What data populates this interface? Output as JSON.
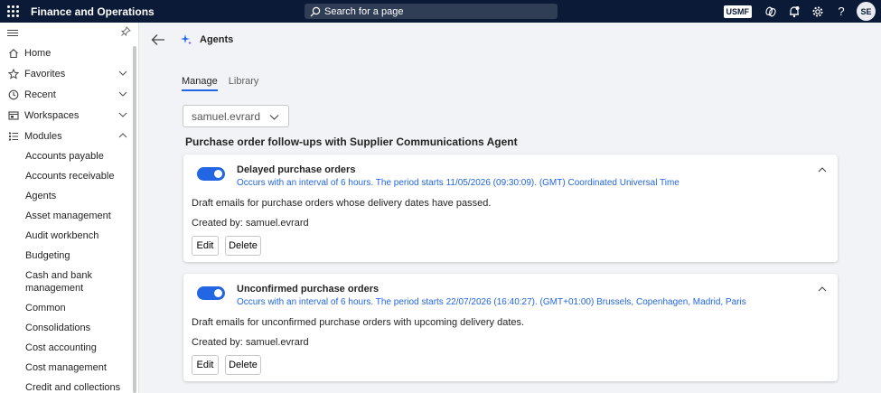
{
  "topbar": {
    "app_title": "Finance and Operations",
    "search_placeholder": "Search for a page",
    "company": "USMF",
    "user_initials": "SE"
  },
  "sidebar": {
    "nav": [
      {
        "label": "Home",
        "icon": "home-icon"
      },
      {
        "label": "Favorites",
        "icon": "star-icon"
      },
      {
        "label": "Recent",
        "icon": "clock-icon"
      },
      {
        "label": "Workspaces",
        "icon": "workspace-icon"
      },
      {
        "label": "Modules",
        "icon": "list-icon"
      }
    ],
    "modules": [
      "Accounts payable",
      "Accounts receivable",
      "Agents",
      "Asset management",
      "Audit workbench",
      "Budgeting",
      "Cash and bank management",
      "Common",
      "Consolidations",
      "Cost accounting",
      "Cost management",
      "Credit and collections"
    ]
  },
  "page": {
    "title": "Agents",
    "tabs": [
      {
        "label": "Manage",
        "active": true
      },
      {
        "label": "Library",
        "active": false
      }
    ],
    "user_select": "samuel.evrard",
    "section_title": "Purchase order follow-ups with Supplier Communications Agent"
  },
  "cards": [
    {
      "enabled": true,
      "title": "Delayed purchase orders",
      "schedule": "Occurs with an interval of 6 hours. The period starts 11/05/2026 (09:30:09). (GMT) Coordinated Universal Time",
      "description": "Draft emails for purchase orders whose delivery dates have passed.",
      "created_by": "Created by: samuel.evrard",
      "edit_label": "Edit",
      "delete_label": "Delete"
    },
    {
      "enabled": true,
      "title": "Unconfirmed purchase orders",
      "schedule": "Occurs with an interval of 6 hours. The period starts 22/07/2026 (16:40:27). (GMT+01:00) Brussels, Copenhagen, Madrid, Paris",
      "description": "Draft emails for unconfirmed purchase orders with upcoming delivery dates.",
      "created_by": "Created by: samuel.evrard",
      "edit_label": "Edit",
      "delete_label": "Delete"
    }
  ],
  "colors": {
    "topbar_bg": "#0b1a36",
    "accent": "#2266e3"
  }
}
